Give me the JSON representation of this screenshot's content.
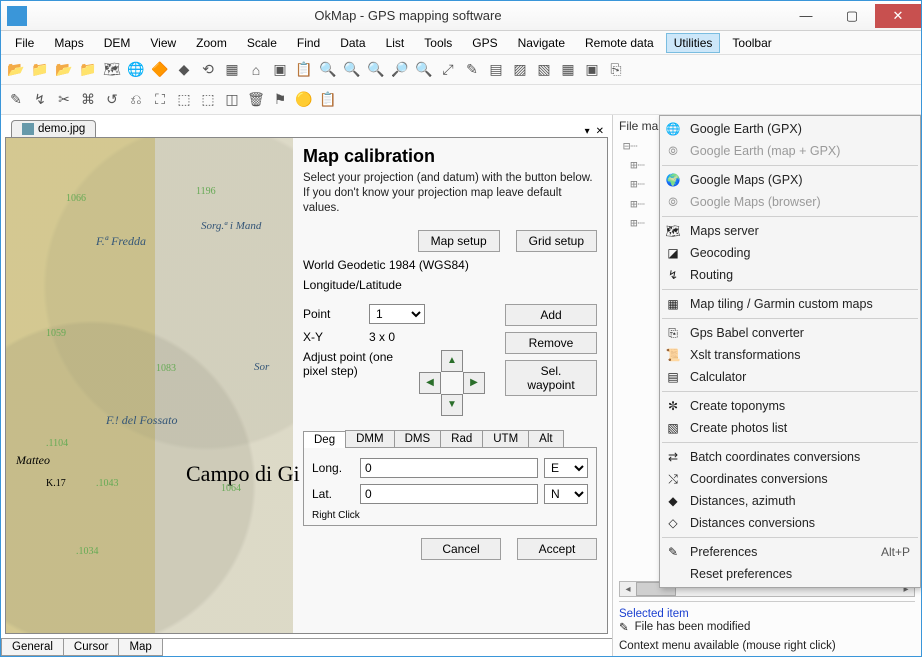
{
  "title": "OkMap - GPS mapping software",
  "menus": [
    "File",
    "Maps",
    "DEM",
    "View",
    "Zoom",
    "Scale",
    "Find",
    "Data",
    "List",
    "Tools",
    "GPS",
    "Navigate",
    "Remote data",
    "Utilities",
    "Toolbar"
  ],
  "active_menu": "Utilities",
  "doc_tab": "demo.jpg",
  "calib": {
    "heading": "Map calibration",
    "desc": "Select your projection (and datum) with the button below. If you don't know your projection map leave default values.",
    "map_setup": "Map setup",
    "grid_setup": "Grid setup",
    "datum": "World Geodetic 1984 (WGS84)",
    "coord_mode": "Longitude/Latitude",
    "point_label": "Point",
    "point_value": "1",
    "xy_label": "X-Y",
    "xy_value": "3 x 0",
    "adjust_label": "Adjust point (one pixel step)",
    "add": "Add",
    "remove": "Remove",
    "sel_wp": "Sel. waypoint",
    "unit_tabs": [
      "Deg",
      "DMM",
      "DMS",
      "Rad",
      "UTM",
      "Alt"
    ],
    "long_label": "Long.",
    "long_value": "0",
    "long_hemi": "E",
    "lat_label": "Lat.",
    "lat_value": "0",
    "lat_hemi": "N",
    "right_click": "Right Click",
    "cancel": "Cancel",
    "accept": "Accept"
  },
  "bottom_tabs": [
    "General",
    "Cursor",
    "Map"
  ],
  "map_labels": {
    "town": "Campo di Gi",
    "fossato": "F.! del Fossato",
    "fredda": "F.ª Fredda",
    "sorg": "Sorg.ª i Mand",
    "sorg2": "Sor",
    "matteo": "Matteo",
    "k17": "K.17"
  },
  "right": {
    "header": "File ma",
    "sel_head": "Selected item",
    "modified": "File has been modified",
    "context": "Context menu available (mouse right click)"
  },
  "dropdown": [
    {
      "t": "item",
      "label": "Google Earth (GPX)",
      "icon": "🌐"
    },
    {
      "t": "item",
      "label": "Google Earth (map + GPX)",
      "disabled": true,
      "icon": "⦾"
    },
    {
      "t": "sep"
    },
    {
      "t": "item",
      "label": "Google Maps (GPX)",
      "icon": "🌍"
    },
    {
      "t": "item",
      "label": "Google Maps (browser)",
      "disabled": true,
      "icon": "⦾"
    },
    {
      "t": "sep"
    },
    {
      "t": "item",
      "label": "Maps server",
      "icon": "🗺"
    },
    {
      "t": "item",
      "label": "Geocoding",
      "icon": "◪"
    },
    {
      "t": "item",
      "label": "Routing",
      "icon": "↯"
    },
    {
      "t": "sep"
    },
    {
      "t": "item",
      "label": "Map tiling / Garmin custom maps",
      "icon": "▦"
    },
    {
      "t": "sep"
    },
    {
      "t": "item",
      "label": "Gps Babel converter",
      "icon": "⎘"
    },
    {
      "t": "item",
      "label": "Xslt transformations",
      "icon": "📜"
    },
    {
      "t": "item",
      "label": "Calculator",
      "icon": "▤"
    },
    {
      "t": "sep"
    },
    {
      "t": "item",
      "label": "Create toponyms",
      "icon": "✼"
    },
    {
      "t": "item",
      "label": "Create photos list",
      "icon": "▧"
    },
    {
      "t": "sep"
    },
    {
      "t": "item",
      "label": "Batch coordinates conversions",
      "icon": "⇄"
    },
    {
      "t": "item",
      "label": "Coordinates conversions",
      "icon": "⤭"
    },
    {
      "t": "item",
      "label": "Distances, azimuth",
      "icon": "◆"
    },
    {
      "t": "item",
      "label": "Distances conversions",
      "icon": "◇"
    },
    {
      "t": "sep"
    },
    {
      "t": "item",
      "label": "Preferences",
      "icon": "✎",
      "shortcut": "Alt+P"
    },
    {
      "t": "item",
      "label": "Reset preferences",
      "icon": ""
    }
  ],
  "toolbar_icons": [
    "📂",
    "📁",
    "📂",
    "📁",
    "🗺",
    "🌐",
    "🔶",
    "◆",
    "⟲",
    "▦",
    "⌂",
    "▣",
    "📋",
    "🔍",
    "🔍",
    "🔍",
    "🔎",
    "🔍",
    "⤢",
    "✎",
    "▤",
    "▨",
    "▧",
    "▦",
    "▣",
    "⎘"
  ],
  "toolbar2_icons": [
    "✎",
    "↯",
    "✂",
    "⌘",
    "↺",
    "⎌",
    "⛶",
    "⬚",
    "⬚",
    "◫",
    "🗑",
    "⚑",
    "🟡",
    "📋"
  ]
}
